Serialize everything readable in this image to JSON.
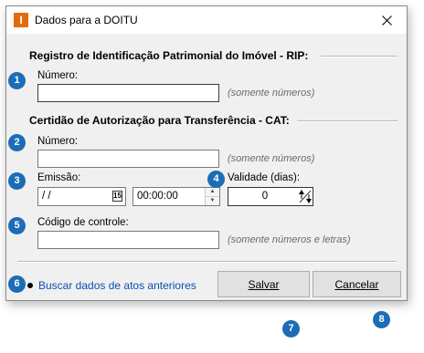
{
  "window": {
    "title": "Dados para a DOITU",
    "app_icon_letter": "I"
  },
  "rip": {
    "heading": "Registro de Identificação Patrimonial do Imóvel - RIP:",
    "numero_label": "Número:",
    "numero_value": "",
    "hint": "(somente números)"
  },
  "cat": {
    "heading": "Certidão de Autorização para Transferência - CAT:",
    "numero_label": "Número:",
    "numero_value": "",
    "numero_hint": "(somente números)",
    "emissao_label": "Emissão:",
    "emissao_date": " / /",
    "calendar_day": "15",
    "emissao_time": "00:00:00",
    "validade_label": "Validade (dias):",
    "validade_value": "0",
    "codigo_label": "Código de controle:",
    "codigo_value": "",
    "codigo_hint": "(somente números e letras)"
  },
  "footer": {
    "link_label": "Buscar dados de atos anteriores",
    "salvar_label": "Salvar",
    "cancelar_label": "Cancelar"
  },
  "badges": [
    "1",
    "2",
    "3",
    "4",
    "5",
    "6",
    "7",
    "8"
  ],
  "colors": {
    "badge": "#1c6db5",
    "app_icon": "#e36c0a",
    "link": "#0a4fb5"
  }
}
